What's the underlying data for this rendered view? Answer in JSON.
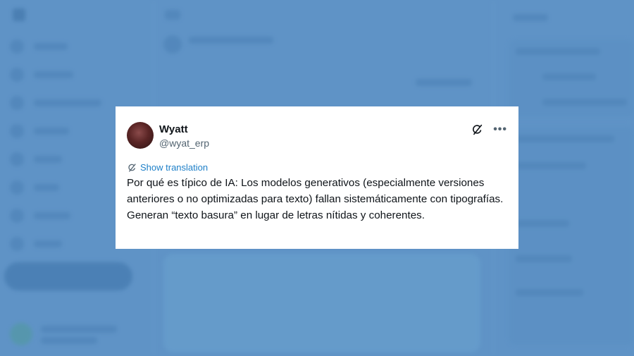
{
  "tweet": {
    "author_name": "Wyatt",
    "author_handle": "@wyat_erp",
    "show_translation": "Show translation",
    "text": "Por qué es típico de IA: Los modelos generativos (especialmente versiones anteriores o no optimizadas para texto) fallan sistemáticamente con tipografías. Generan “texto basura” en lugar de letras nítidas y coherentes."
  },
  "icons": {
    "avatar": "profile-photo",
    "grok": "grok-icon",
    "more": "more-icon",
    "translate": "translate-icon"
  },
  "colors": {
    "overlay_background": "#5f93c6",
    "card_background": "#ffffff",
    "text_primary": "#0f1419",
    "text_secondary": "#536471",
    "link": "#1d7fc8"
  }
}
